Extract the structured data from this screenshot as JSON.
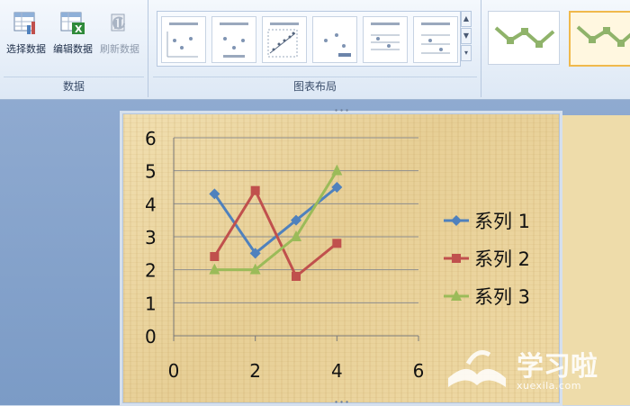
{
  "ribbon": {
    "data_group": {
      "label": "数据",
      "buttons": [
        {
          "label": "选择数据",
          "icon": "select-data-icon",
          "enabled": true
        },
        {
          "label": "编辑数据",
          "icon": "edit-data-excel-icon",
          "enabled": true
        },
        {
          "label": "刷新数据",
          "icon": "refresh-data-icon",
          "enabled": false
        }
      ]
    },
    "layout_group": {
      "label": "图表布局",
      "thumbnail_count": 6
    },
    "style_group": {
      "selected_index": 1
    }
  },
  "chart_data": {
    "type": "line",
    "title": "",
    "xlabel": "",
    "ylabel": "",
    "xlim": [
      0,
      6
    ],
    "ylim": [
      0,
      6
    ],
    "xticks": [
      0,
      2,
      4,
      6
    ],
    "yticks": [
      0,
      1,
      2,
      3,
      4,
      5,
      6
    ],
    "grid": true,
    "legend_position": "right",
    "series": [
      {
        "name": "系列 1",
        "color": "#4f81bd",
        "marker": "diamond",
        "x": [
          1,
          2,
          3,
          4
        ],
        "y": [
          4.3,
          2.5,
          3.5,
          4.5
        ]
      },
      {
        "name": "系列 2",
        "color": "#c0504d",
        "marker": "square",
        "x": [
          1,
          2,
          3,
          4
        ],
        "y": [
          2.4,
          4.4,
          1.8,
          2.8
        ]
      },
      {
        "name": "系列 3",
        "color": "#9bbb59",
        "marker": "triangle",
        "x": [
          1,
          2,
          3,
          4
        ],
        "y": [
          2.0,
          2.0,
          3.0,
          5.0
        ]
      }
    ]
  },
  "watermark": {
    "title": "学习啦",
    "url": "xuexila.com"
  },
  "colors": {
    "ribbon_bg": "#dde8f5",
    "workspace_bg": "#7b9bc6",
    "chart_bg": "#ecd6a2",
    "style_selected_border": "#f0b94c"
  }
}
